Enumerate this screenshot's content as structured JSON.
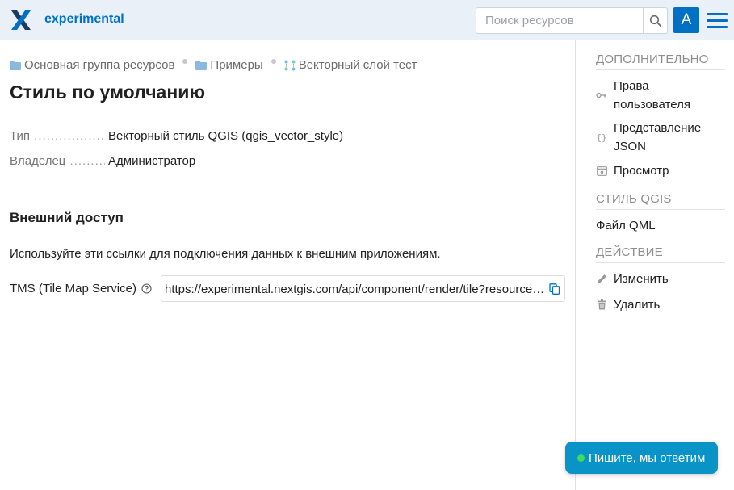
{
  "header": {
    "app_name": "experimental",
    "search_placeholder": "Поиск ресурсов",
    "avatar_letter": "A"
  },
  "breadcrumb": [
    {
      "label": "Основная группа ресурсов",
      "icon": "folder-icon"
    },
    {
      "label": "Примеры",
      "icon": "folder-icon"
    },
    {
      "label": "Векторный слой тест",
      "icon": "vector-layer-icon"
    }
  ],
  "page_title": "Стиль по умолчанию",
  "properties": [
    {
      "key": "Тип",
      "value": "Векторный стиль QGIS (qgis_vector_style)"
    },
    {
      "key": "Владелец",
      "value": "Администратор"
    }
  ],
  "external_access": {
    "title": "Внешний доступ",
    "description": "Используйте эти ссылки для подключения данных к внешним приложениям.",
    "tms_label": "TMS (Tile Map Service)",
    "tms_url": "https://experimental.nextgis.com/api/component/render/tile?resource=…"
  },
  "sidebar": {
    "sections": [
      {
        "title": "ДОПОЛНИТЕЛЬНО",
        "items": [
          {
            "label": "Права пользователя",
            "icon": "key-icon"
          },
          {
            "label": "Представление JSON",
            "icon": "braces-icon"
          },
          {
            "label": "Просмотр",
            "icon": "preview-icon"
          }
        ]
      },
      {
        "title": "СТИЛЬ QGIS",
        "items": [
          {
            "label": "Файл QML",
            "icon": ""
          }
        ]
      },
      {
        "title": "ДЕЙСТВИЕ",
        "items": [
          {
            "label": "Изменить",
            "icon": "pencil-icon"
          },
          {
            "label": "Удалить",
            "icon": "trash-icon"
          }
        ]
      }
    ]
  },
  "chat": {
    "label": "Пишите, мы ответим"
  },
  "colors": {
    "accent": "#0070c5",
    "header_bg": "#e9f0f8",
    "chat_bg": "#0a93c7"
  }
}
